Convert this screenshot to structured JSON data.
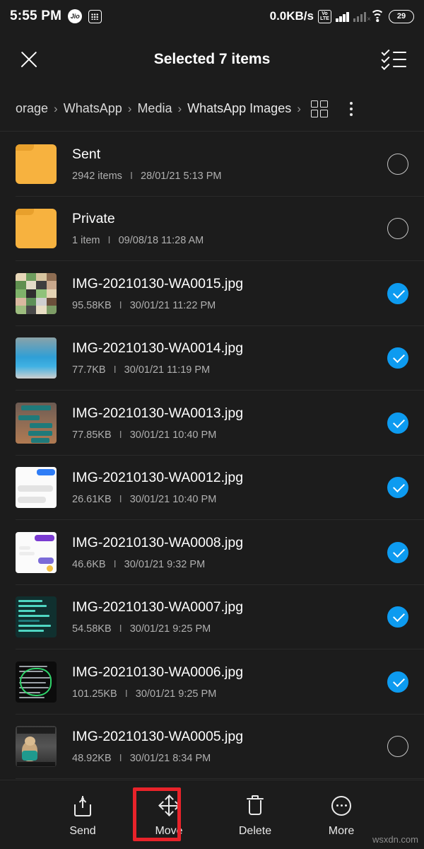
{
  "statusbar": {
    "time": "5:55 PM",
    "carrier_badge": "Jio",
    "grid_badge_name": "dots-grid-icon",
    "network_speed": "0.0KB/s",
    "volte_line1": "Vo",
    "volte_line2": "LTE",
    "battery": "29"
  },
  "actionbar": {
    "close_label": "",
    "title": "Selected 7 items",
    "select_all_label": ""
  },
  "breadcrumb": {
    "items": [
      {
        "label": "orage"
      },
      {
        "label": "WhatsApp"
      },
      {
        "label": "Media"
      },
      {
        "label": "WhatsApp Images"
      }
    ],
    "separator": "›",
    "trailing_separator": "›"
  },
  "list": {
    "rows": [
      {
        "type": "folder",
        "name": "Sent",
        "size": "2942 items",
        "date": "28/01/21 5:13 PM",
        "selected": false,
        "thumb": "folder-icon"
      },
      {
        "type": "folder",
        "name": "Private",
        "size": "1 item",
        "date": "09/08/18 11:28 AM",
        "selected": false,
        "thumb": "folder-icon"
      },
      {
        "type": "file",
        "name": "IMG-20210130-WA0015.jpg",
        "size": "95.58KB",
        "date": "30/01/21 11:22 PM",
        "selected": true,
        "thumb": "collage-photo-thumbnail"
      },
      {
        "type": "file",
        "name": "IMG-20210130-WA0014.jpg",
        "size": "77.7KB",
        "date": "30/01/21 11:19 PM",
        "selected": true,
        "thumb": "sky-screenshot-thumbnail"
      },
      {
        "type": "file",
        "name": "IMG-20210130-WA0013.jpg",
        "size": "77.85KB",
        "date": "30/01/21 10:40 PM",
        "selected": true,
        "thumb": "teal-chat-screenshot-thumbnail"
      },
      {
        "type": "file",
        "name": "IMG-20210130-WA0012.jpg",
        "size": "26.61KB",
        "date": "30/01/21 10:40 PM",
        "selected": true,
        "thumb": "white-chat-screenshot-thumbnail"
      },
      {
        "type": "file",
        "name": "IMG-20210130-WA0008.jpg",
        "size": "46.6KB",
        "date": "30/01/21 9:32 PM",
        "selected": true,
        "thumb": "purple-chat-screenshot-thumbnail"
      },
      {
        "type": "file",
        "name": "IMG-20210130-WA0007.jpg",
        "size": "54.58KB",
        "date": "30/01/21 9:25 PM",
        "selected": true,
        "thumb": "dark-teal-text-thumbnail"
      },
      {
        "type": "file",
        "name": "IMG-20210130-WA0006.jpg",
        "size": "101.25KB",
        "date": "30/01/21 9:25 PM",
        "selected": true,
        "thumb": "dark-annotated-screenshot-thumbnail"
      },
      {
        "type": "file",
        "name": "IMG-20210130-WA0005.jpg",
        "size": "48.92KB",
        "date": "30/01/21 8:34 PM",
        "selected": false,
        "thumb": "teddy-bear-meme-thumbnail"
      }
    ],
    "separator": "I"
  },
  "toolbar": {
    "items": [
      {
        "label": "Send",
        "icon": "share-icon",
        "highlighted": false
      },
      {
        "label": "Move",
        "icon": "move-arrows-icon",
        "highlighted": true
      },
      {
        "label": "Delete",
        "icon": "trash-icon",
        "highlighted": false
      },
      {
        "label": "More",
        "icon": "more-circle-icon",
        "highlighted": false
      }
    ]
  },
  "colors": {
    "background": "#1c1c1c",
    "accent_selected": "#0d9bf0",
    "folder": "#f7b23f",
    "highlight": "#e8232a",
    "text_primary": "#ffffff",
    "text_secondary": "#b0b0b0"
  },
  "watermark": "wsxdn.com"
}
